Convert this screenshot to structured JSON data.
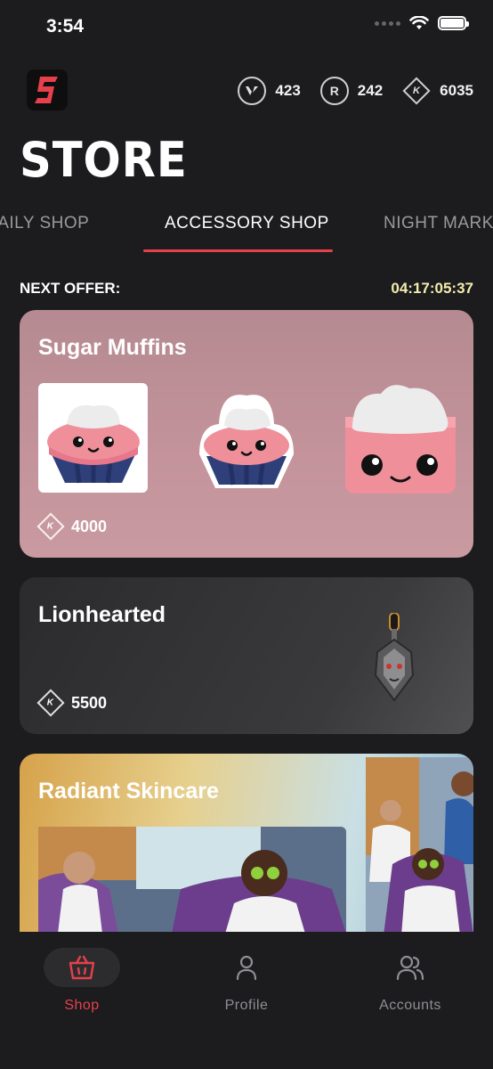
{
  "status_bar": {
    "time": "3:54"
  },
  "header": {
    "currencies": [
      {
        "icon": "valorant-points-icon",
        "value": "423"
      },
      {
        "icon": "radianite-icon",
        "value": "242"
      },
      {
        "icon": "kingdom-credits-icon",
        "value": "6035"
      }
    ],
    "title": "STORE"
  },
  "tabs": [
    {
      "label": "DAILY SHOP"
    },
    {
      "label": "ACCESSORY SHOP"
    },
    {
      "label": "NIGHT MARKET"
    }
  ],
  "offer": {
    "label": "NEXT OFFER:",
    "countdown": "04:17:05:37"
  },
  "cards": [
    {
      "title": "Sugar Muffins",
      "price": "4000"
    },
    {
      "title": "Lionhearted",
      "price": "5500"
    },
    {
      "title": "Radiant Skincare"
    }
  ],
  "nav": [
    {
      "label": "Shop"
    },
    {
      "label": "Profile"
    },
    {
      "label": "Accounts"
    }
  ],
  "colors": {
    "accent": "#e5404b",
    "countdown": "#f3ecae",
    "background": "#1c1c1e"
  }
}
